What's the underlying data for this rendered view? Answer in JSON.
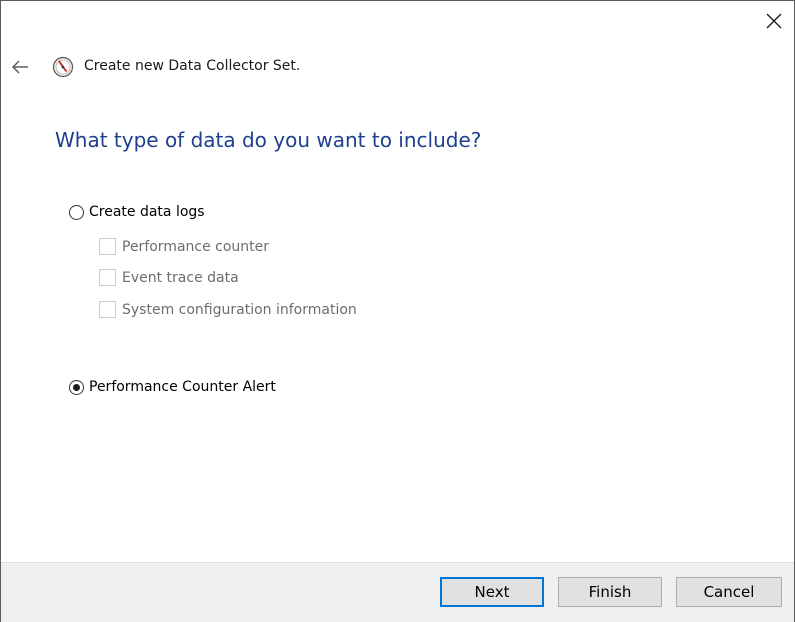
{
  "window": {
    "title": "Create new Data Collector Set.",
    "close_icon": "close-icon",
    "back_icon": "back-arrow-icon",
    "app_icon": "performance-monitor-icon"
  },
  "main": {
    "heading": "What type of data do you want to include?",
    "options": [
      {
        "label": "Create data logs",
        "type": "radio",
        "checked": false
      },
      {
        "label": "Performance Counter Alert",
        "type": "radio",
        "checked": true
      }
    ],
    "data_log_items": [
      {
        "label": "Performance counter",
        "checked": false,
        "enabled": false
      },
      {
        "label": "Event trace data",
        "checked": false,
        "enabled": false
      },
      {
        "label": "System configuration information",
        "checked": false,
        "enabled": false
      }
    ]
  },
  "footer": {
    "next_label": "Next",
    "finish_label": "Finish",
    "cancel_label": "Cancel"
  },
  "colors": {
    "heading": "#1f3f8f",
    "default_button_border": "#0078d7",
    "footer_background": "#f0f0f0"
  }
}
